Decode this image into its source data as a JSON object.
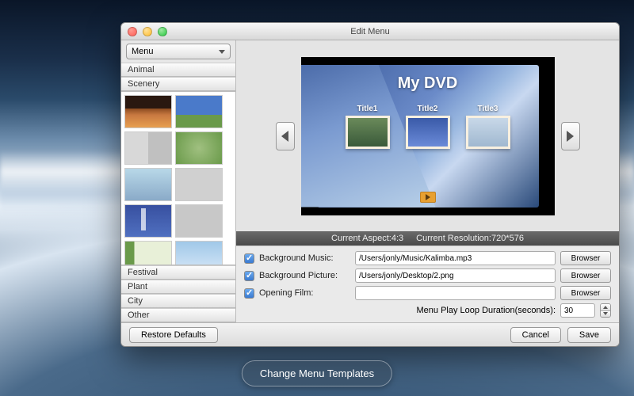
{
  "window": {
    "title": "Edit Menu"
  },
  "sidebar": {
    "selector": "Menu",
    "top_categories": [
      "Animal",
      "Scenery"
    ],
    "bottom_categories": [
      "Festival",
      "Plant",
      "City",
      "Other"
    ],
    "restore_label": "Restore Defaults"
  },
  "preview": {
    "title": "My DVD",
    "titles": [
      "Title1",
      "Title2",
      "Title3"
    ]
  },
  "status": {
    "aspect_label": "Current Aspect:",
    "aspect_value": "4:3",
    "resolution_label": "Current Resolution:",
    "resolution_value": "720*576"
  },
  "form": {
    "bg_music": {
      "label": "Background Music:",
      "value": "/Users/jonly/Music/Kalimba.mp3",
      "checked": true,
      "browse": "Browser"
    },
    "bg_picture": {
      "label": "Background Picture:",
      "value": "/Users/jonly/Desktop/2.png",
      "checked": true,
      "browse": "Browser"
    },
    "opening_film": {
      "label": "Opening Film:",
      "value": "",
      "checked": true,
      "browse": "Browser"
    },
    "duration_label": "Menu Play Loop Duration(seconds):",
    "duration_value": "30"
  },
  "footer": {
    "cancel": "Cancel",
    "save": "Save"
  },
  "pill": "Change Menu Templates"
}
